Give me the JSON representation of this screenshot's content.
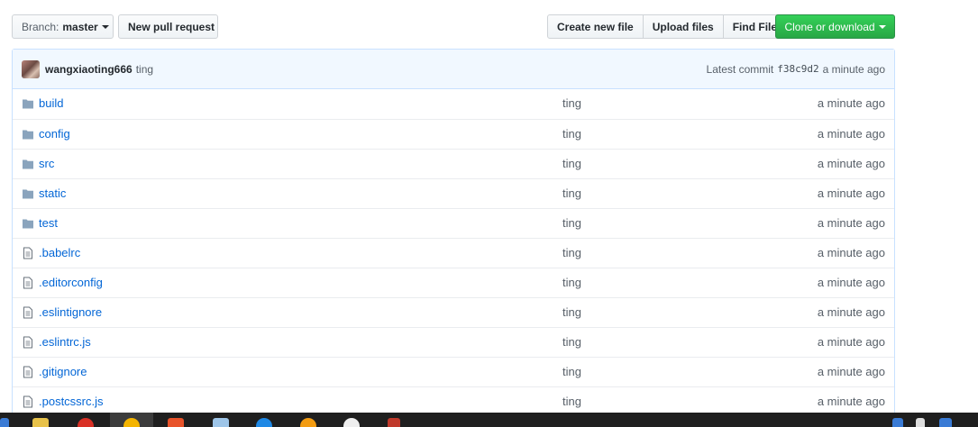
{
  "toolbar": {
    "branch_prefix": "Branch:",
    "branch_name": "master",
    "new_pr_label": "New pull request",
    "create_file_label": "Create new file",
    "upload_files_label": "Upload files",
    "find_file_label": "Find File",
    "clone_label": "Clone or download"
  },
  "commit": {
    "author": "wangxiaoting666",
    "message": "ting",
    "latest_label": "Latest commit",
    "sha": "f38c9d2",
    "age": "a minute ago"
  },
  "files": [
    {
      "name": "build",
      "type": "folder",
      "message": "ting",
      "age": "a minute ago"
    },
    {
      "name": "config",
      "type": "folder",
      "message": "ting",
      "age": "a minute ago"
    },
    {
      "name": "src",
      "type": "folder",
      "message": "ting",
      "age": "a minute ago"
    },
    {
      "name": "static",
      "type": "folder",
      "message": "ting",
      "age": "a minute ago"
    },
    {
      "name": "test",
      "type": "folder",
      "message": "ting",
      "age": "a minute ago"
    },
    {
      "name": ".babelrc",
      "type": "file",
      "message": "ting",
      "age": "a minute ago"
    },
    {
      "name": ".editorconfig",
      "type": "file",
      "message": "ting",
      "age": "a minute ago"
    },
    {
      "name": ".eslintignore",
      "type": "file",
      "message": "ting",
      "age": "a minute ago"
    },
    {
      "name": ".eslintrc.js",
      "type": "file",
      "message": "ting",
      "age": "a minute ago"
    },
    {
      "name": ".gitignore",
      "type": "file",
      "message": "ting",
      "age": "a minute ago"
    },
    {
      "name": ".postcssrc.js",
      "type": "file",
      "message": "ting",
      "age": "a minute ago"
    }
  ],
  "colors": {
    "link": "#0366d6",
    "clone_button": "#28a745",
    "commit_bar": "#f1f8ff",
    "folder_icon": "#79b8ff"
  }
}
